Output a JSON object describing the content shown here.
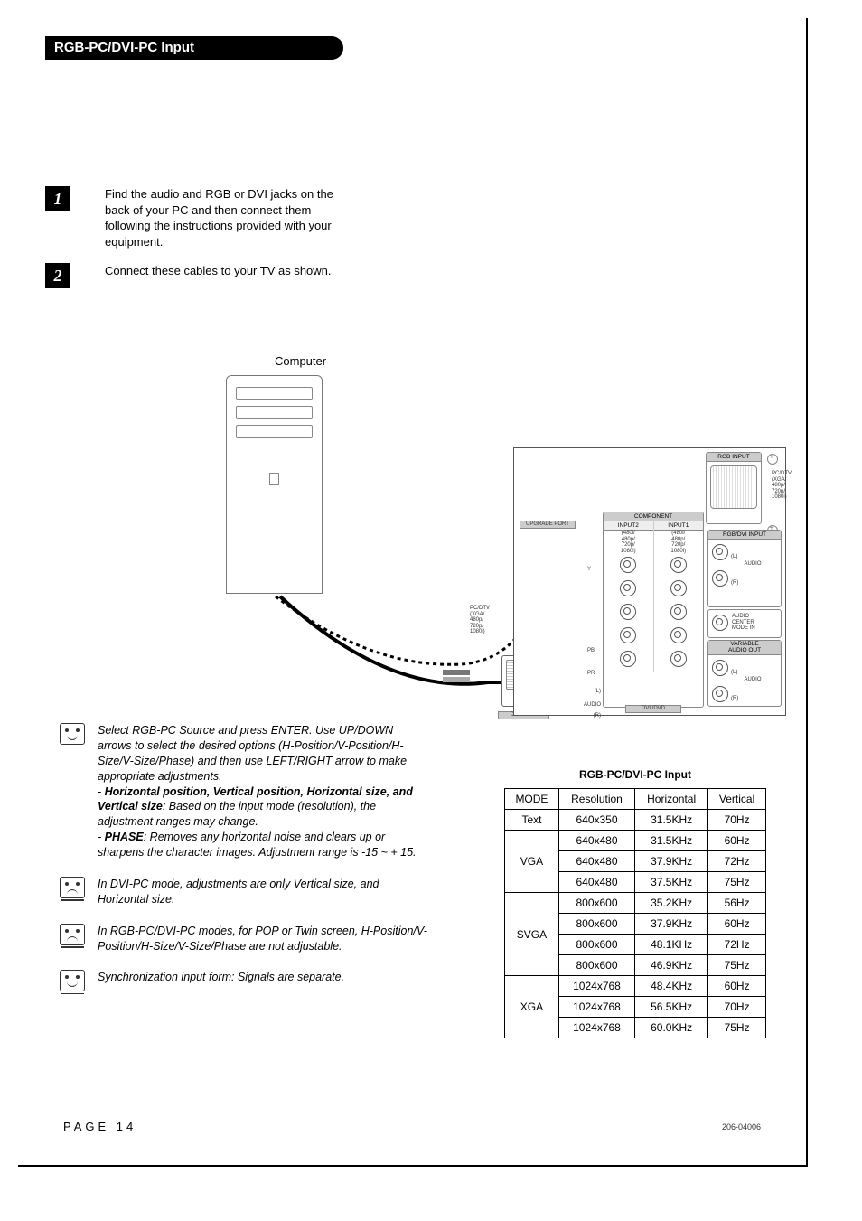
{
  "title": "RGB-PC/DVI-PC Input",
  "steps": [
    {
      "num": "1",
      "text": "Find the audio and RGB or DVI jacks on the back of your PC and then connect them following the instructions provided with your equipment."
    },
    {
      "num": "2",
      "text": "Connect these cables to your TV as shown."
    }
  ],
  "diagram": {
    "computer_label": "Computer",
    "panel": {
      "rgb_input": "RGB INPUT",
      "rgb_dvi_input": "RGB/DVI INPUT",
      "pc_dtv": "PC/DTV\n(XGA/\n480p/\n720p/\n1080i)",
      "component": "COMPONENT",
      "input1": "INPUT1",
      "input2": "INPUT2",
      "upgrade_port": "UPGRADE PORT",
      "ranges": "(480i/\n480p/\n720p/\n1080i)",
      "audio": "AUDIO",
      "audio_center": "AUDIO\nCENTER\nMODE IN",
      "variable_audio_out": "VARIABLE\nAUDIO OUT",
      "l": "(L)",
      "r": "(R)",
      "pb": "PB",
      "pr": "PR",
      "y": "Y",
      "dvi_input": "DVI INPUT",
      "dvi_dvd": "DVI /DVD"
    }
  },
  "notes": [
    {
      "face": "smile",
      "lines": [
        {
          "t": "Select RGB-PC Source and press ENTER. Use UP/DOWN arrows to select the desired options (H-Position/V-Position/H-Size/V-Size/Phase) and then use LEFT/RIGHT arrow to make appropriate adjustments."
        },
        {
          "t": "- ",
          "b": "Horizontal position, Vertical position, Horizontal size, and Vertical size",
          "t2": ": Based on the input mode (resolution), the adjustment ranges may change."
        },
        {
          "t": "- ",
          "b": "PHASE",
          "t2": ": Removes any horizontal noise and clears up or sharpens the character images. Adjustment range is -15 ~ + 15."
        }
      ]
    },
    {
      "face": "frown",
      "lines": [
        {
          "t": "In DVI-PC mode, adjustments are only Vertical size, and Horizontal size."
        }
      ]
    },
    {
      "face": "frown",
      "lines": [
        {
          "t": "In RGB-PC/DVI-PC modes, for POP or Twin screen, H-Position/V-Position/H-Size/V-Size/Phase are not adjustable."
        }
      ]
    },
    {
      "face": "smile",
      "lines": [
        {
          "t": "Synchronization input form: Signals are separate."
        }
      ]
    }
  ],
  "table_caption": "RGB-PC/DVI-PC Input",
  "chart_data": {
    "type": "table",
    "headers": [
      "MODE",
      "Resolution",
      "Horizontal",
      "Vertical"
    ],
    "rows": [
      {
        "mode": "Text",
        "resolution": "640x350",
        "horizontal": "31.5KHz",
        "vertical": "70Hz"
      },
      {
        "mode": "VGA",
        "resolution": "640x480",
        "horizontal": "31.5KHz",
        "vertical": "60Hz"
      },
      {
        "mode": "VGA",
        "resolution": "640x480",
        "horizontal": "37.9KHz",
        "vertical": "72Hz"
      },
      {
        "mode": "VGA",
        "resolution": "640x480",
        "horizontal": "37.5KHz",
        "vertical": "75Hz"
      },
      {
        "mode": "SVGA",
        "resolution": "800x600",
        "horizontal": "35.2KHz",
        "vertical": "56Hz"
      },
      {
        "mode": "SVGA",
        "resolution": "800x600",
        "horizontal": "37.9KHz",
        "vertical": "60Hz"
      },
      {
        "mode": "SVGA",
        "resolution": "800x600",
        "horizontal": "48.1KHz",
        "vertical": "72Hz"
      },
      {
        "mode": "SVGA",
        "resolution": "800x600",
        "horizontal": "46.9KHz",
        "vertical": "75Hz"
      },
      {
        "mode": "XGA",
        "resolution": "1024x768",
        "horizontal": "48.4KHz",
        "vertical": "60Hz"
      },
      {
        "mode": "XGA",
        "resolution": "1024x768",
        "horizontal": "56.5KHz",
        "vertical": "70Hz"
      },
      {
        "mode": "XGA",
        "resolution": "1024x768",
        "horizontal": "60.0KHz",
        "vertical": "75Hz"
      }
    ],
    "mode_spans": {
      "Text": 1,
      "VGA": 3,
      "SVGA": 4,
      "XGA": 3
    }
  },
  "footer": {
    "page": "PAGE 14",
    "docnum": "206-04006"
  }
}
